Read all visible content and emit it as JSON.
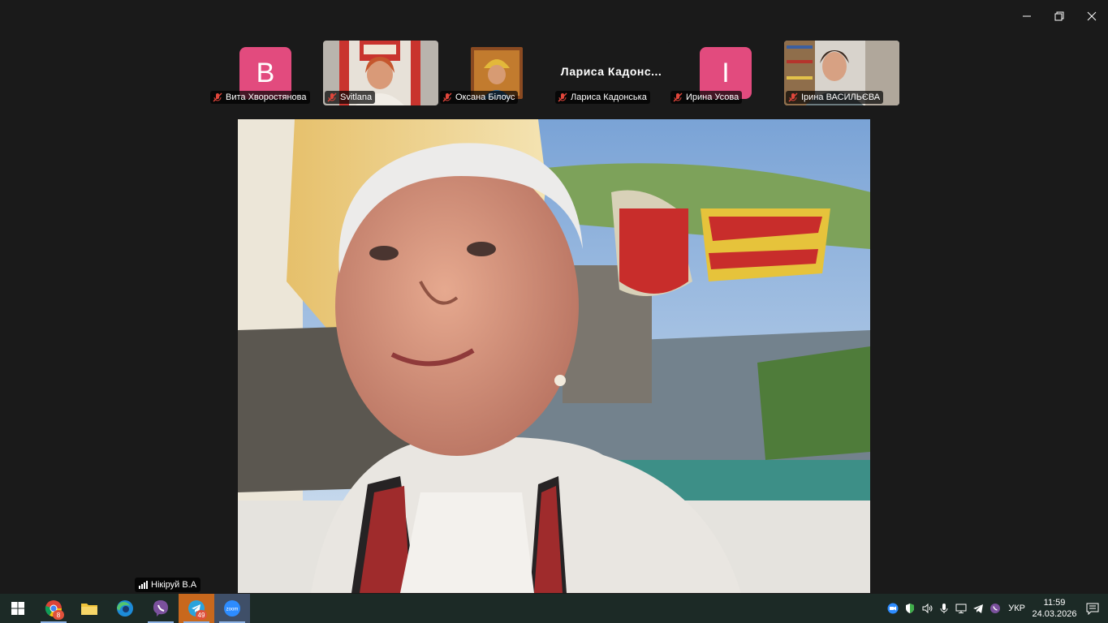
{
  "window": {
    "controls": [
      "minimize-icon",
      "restore-icon",
      "close-icon"
    ]
  },
  "participants": [
    {
      "name": "Вита Хворостянова",
      "avatar_letter": "B",
      "type": "avatar",
      "muted": true
    },
    {
      "name": "Svitlana",
      "type": "video",
      "muted": true
    },
    {
      "name": "Оксана Білоус",
      "type": "video",
      "muted": true
    },
    {
      "name": "Лариса Кадонська",
      "display_name": "Лариса  Кадонс...",
      "type": "name",
      "muted": true
    },
    {
      "name": "Ирина Усова",
      "avatar_letter": "I",
      "type": "avatar",
      "muted": true
    },
    {
      "name": "Ірина ВАСИЛЬЄВА",
      "type": "video",
      "muted": true
    }
  ],
  "active_speaker": {
    "name": "Нікіруй В.А",
    "icon": "signal-strength-icon"
  },
  "taskbar": {
    "apps": [
      {
        "name": "start",
        "icon": "windows-start-icon"
      },
      {
        "name": "chrome",
        "icon": "chrome-icon",
        "badge": "8"
      },
      {
        "name": "file-explorer",
        "icon": "folder-icon"
      },
      {
        "name": "edge",
        "icon": "edge-icon"
      },
      {
        "name": "viber",
        "icon": "viber-icon"
      },
      {
        "name": "telegram",
        "icon": "telegram-icon",
        "badge": "49"
      },
      {
        "name": "zoom",
        "icon": "zoom-icon",
        "label": "zoom"
      }
    ],
    "tray": {
      "language": "УКР",
      "time": "11:59",
      "date": "24.03.2026"
    }
  },
  "colors": {
    "avatar": "#e24b7e",
    "taskbar": "#1c2a26",
    "muted_icon": "#e0463b"
  }
}
